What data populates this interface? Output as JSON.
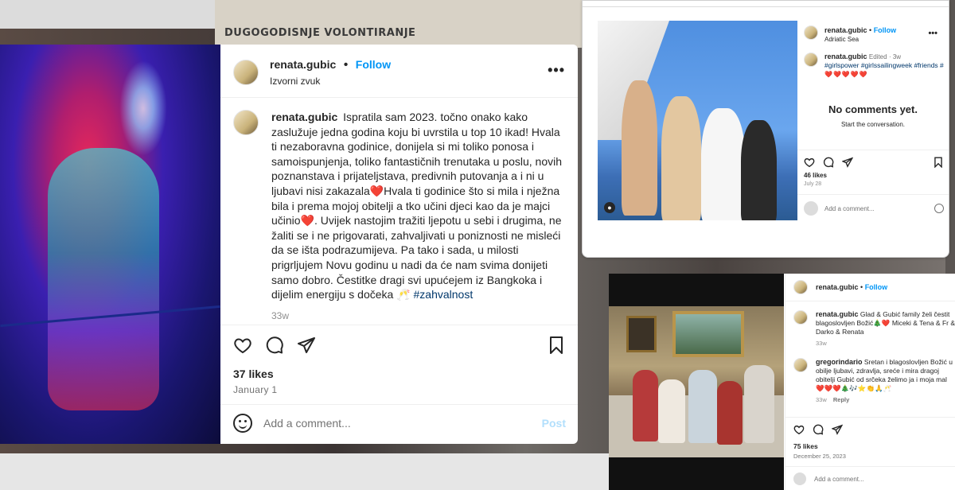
{
  "background": {
    "top_text": "DUGOGODISNJE VOLONTIRANJE"
  },
  "main_post": {
    "username": "renata.gubic",
    "follow_label": "Follow",
    "audio": "Izvorni zvuk",
    "caption_username": "renata.gubic",
    "caption_text": "Ispratila sam 2023. točno onako kako zaslužuje jedna godina koju bi uvrstila u top 10 ikad! Hvala ti nezaboravna godinice, donijela si mi toliko ponosa i samoispunjenja, toliko fantastičnih trenutaka u poslu, novih poznanstava i prijateljstava, predivnih putovanja a i ni u ljubavi nisi zakazala❤️Hvala ti godinice što si mila i nježna bila i prema mojoj obitelji a tko učini djeci kao da je majci učinio❤️. Uvijek nastojim tražiti ljepotu u sebi i drugima, ne žaliti se i ne prigovarati, zahvaljivati u poniznosti ne misleći da se išta podrazumijeva. Pa tako i sada, u milosti prigrljujem Novu godinu u nadi da će nam svima donijeti samo dobro. Čestitke dragi svi upućejem iz Bangkoka i dijelim energiju s dočeka 🥂",
    "caption_hashtag": "#zahvalnost",
    "time_ago": "33w",
    "likes": "37 likes",
    "date": "January 1",
    "comment_placeholder": "Add a comment...",
    "post_label": "Post",
    "icons": [
      "heart-icon",
      "comment-icon",
      "share-icon",
      "bookmark-icon",
      "emoji-icon",
      "mute-icon",
      "more-icon"
    ]
  },
  "top_right_post": {
    "username": "renata.gubic",
    "follow_label": "Follow",
    "location": "Adriatic Sea",
    "caption_username": "renata.gubic",
    "edited": "Edited",
    "time_ago": "3w",
    "hashtags": "#girlspower #girlssailingweek #friends #",
    "hearts": "❤️❤️❤️❤️❤️",
    "no_comments_title": "No comments yet.",
    "no_comments_sub": "Start the conversation.",
    "likes": "46 likes",
    "date": "July 28",
    "comment_placeholder": "Add a comment..."
  },
  "bottom_right_post": {
    "username": "renata.gubic",
    "follow_label": "Follow",
    "comments": [
      {
        "username": "renata.gubic",
        "text": "Glad & Gubić family želi čestit blagoslovljen Božić🎄❤️ Miceki & Tena & Fr & Darko & Renata",
        "time": "33w",
        "reply": ""
      },
      {
        "username": "gregorindario",
        "text": "Sretan i blagoslovljen Božić u obilje ljubavi, zdravlja, sreće i mira dragoj obitelji Gubić od srčeka želimo ja i moja mal ❤️❤️❤️🎄🎶⭐👏🙏🥂",
        "time": "33w",
        "reply": "Reply"
      }
    ],
    "likes": "75 likes",
    "date": "December 25, 2023",
    "comment_placeholder": "Add a comment..."
  },
  "colors": {
    "follow_blue": "#0095f6",
    "hashtag": "#00376b",
    "post_disabled": "#b2dffc",
    "heart_red": "#ed4956"
  }
}
